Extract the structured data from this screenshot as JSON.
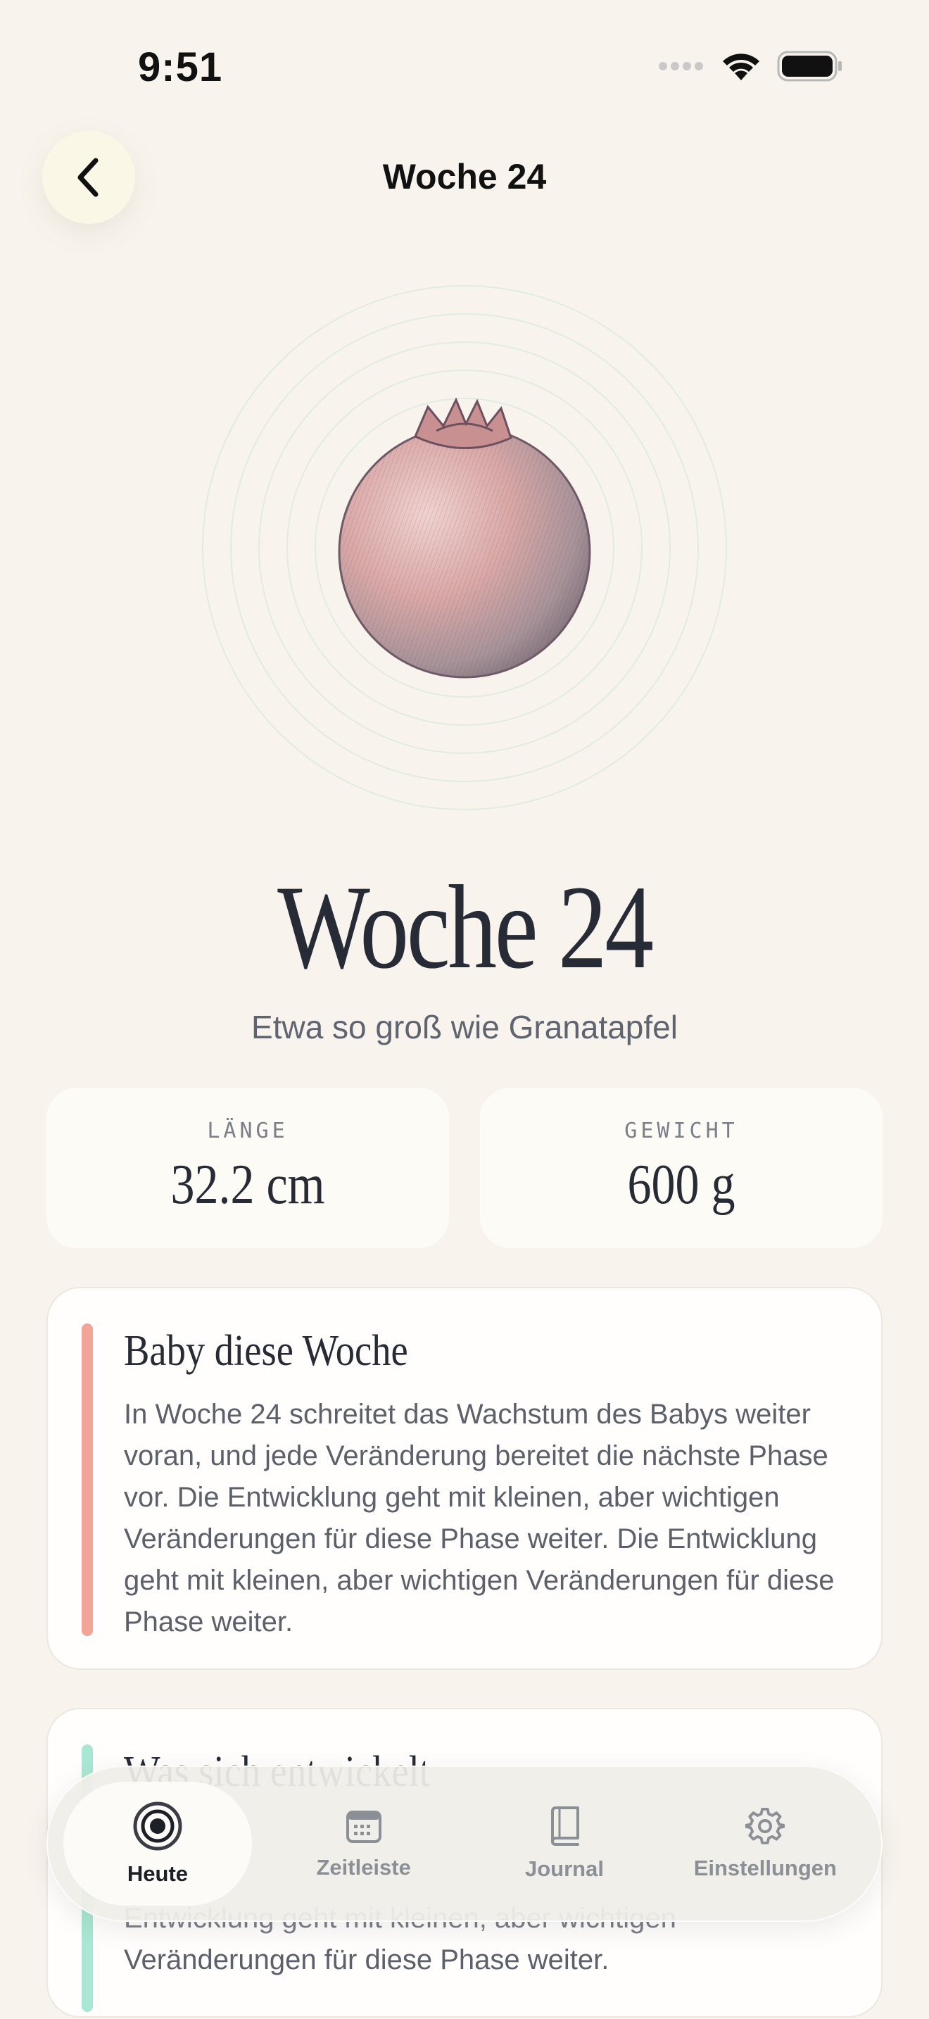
{
  "status": {
    "time": "9:51",
    "icons": [
      "signal-dots-icon",
      "wifi-icon",
      "battery-icon"
    ]
  },
  "nav": {
    "back_icon": "chevron-left-icon",
    "title": "Woche 24"
  },
  "hero": {
    "image": "pomegranate-illustration",
    "title": "Woche 24",
    "subtitle": "Etwa so groß wie Granatapfel"
  },
  "stats": {
    "length": {
      "label": "LÄNGE",
      "value": "32.2 cm"
    },
    "weight": {
      "label": "GEWICHT",
      "value": "600 g"
    }
  },
  "cards": {
    "baby": {
      "title": "Baby diese Woche",
      "body": "In Woche 24 schreitet das Wachstum des Babys weiter voran, und jede Veränderung bereitet die nächste Phase vor. Die Entwicklung geht mit kleinen, aber wichtigen Veränderungen für diese Phase weiter. Die Entwicklung geht mit kleinen, aber wichtigen Veränderungen für diese Phase weiter."
    },
    "development": {
      "title": "Was sich entwickelt",
      "body_partial": "Entwicklung geht mit kleinen, aber wichtigen",
      "body_last": "Veränderungen für diese Phase weiter."
    }
  },
  "tabbar": {
    "tabs": [
      {
        "label": "Heute",
        "icon": "target-icon",
        "active": true
      },
      {
        "label": "Zeitleiste",
        "icon": "calendar-icon",
        "active": false
      },
      {
        "label": "Journal",
        "icon": "book-icon",
        "active": false
      },
      {
        "label": "Einstellungen",
        "icon": "gear-icon",
        "active": false
      }
    ]
  },
  "colors": {
    "background": "#f8f4ed",
    "baby_accent": "#f4a397",
    "development_accent": "#a9e6d4",
    "text_dark": "#262b36",
    "text_muted": "#5b606b"
  }
}
